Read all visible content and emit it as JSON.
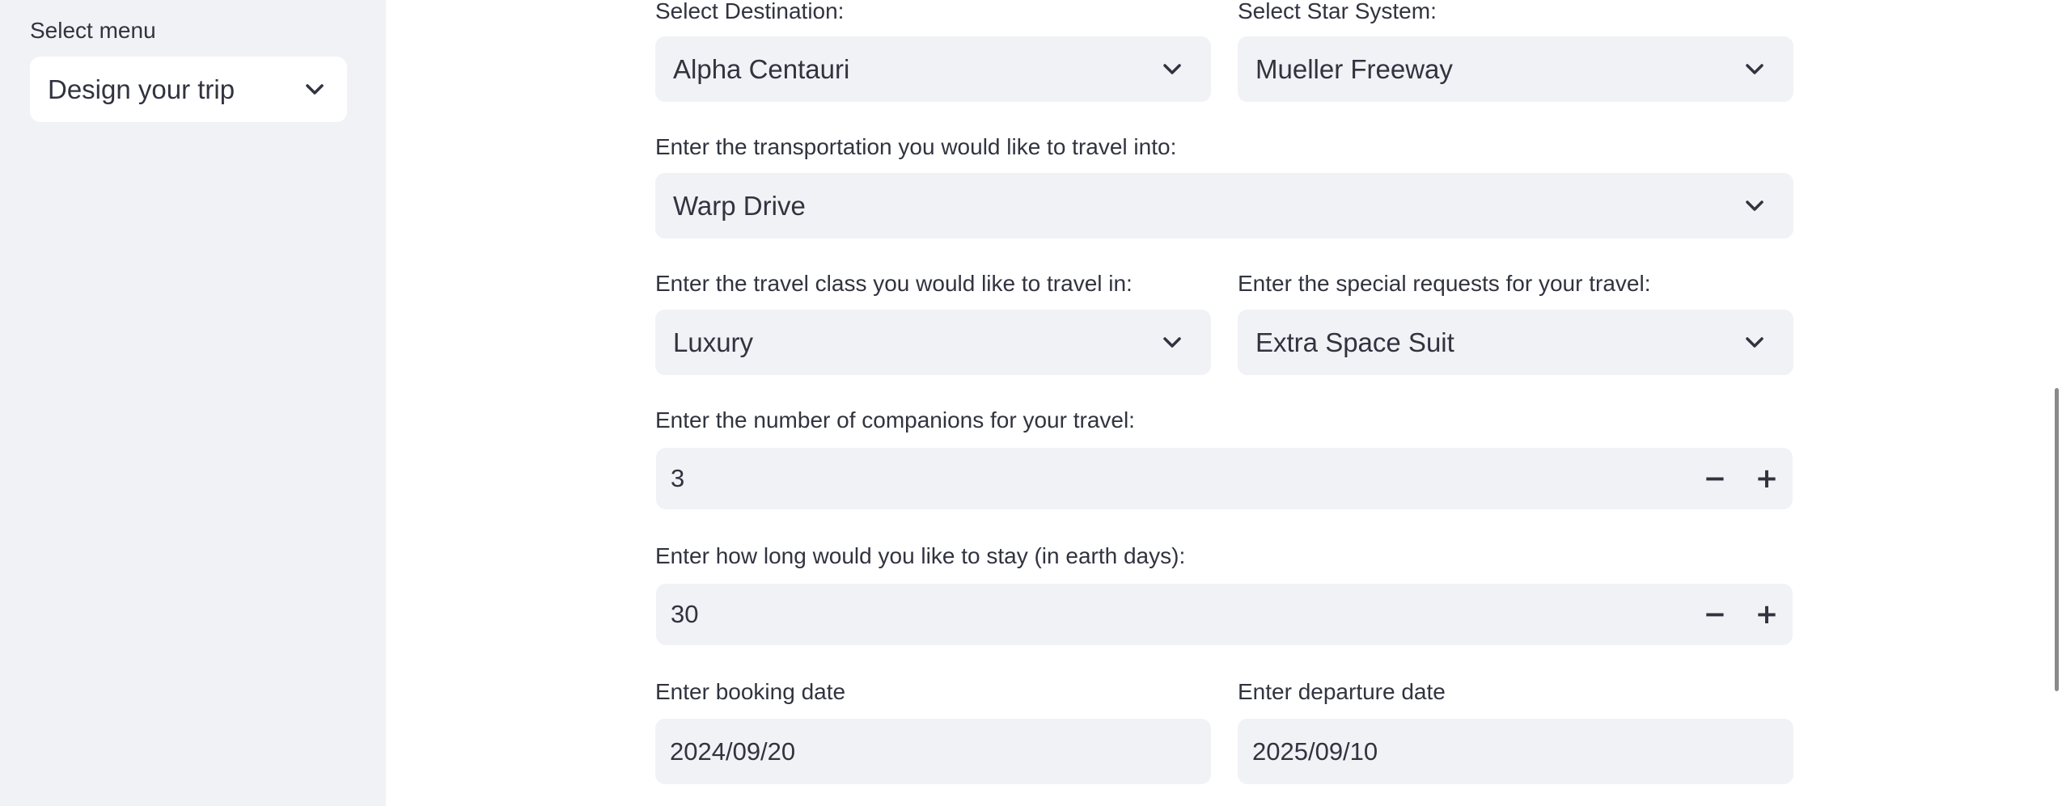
{
  "sidebar": {
    "label": "Select menu",
    "selected": "Design your trip"
  },
  "form": {
    "destination": {
      "label": "Select Destination:",
      "value": "Alpha Centauri"
    },
    "star_system": {
      "label": "Select Star System:",
      "value": "Mueller Freeway"
    },
    "transportation": {
      "label": "Enter the transportation you would like to travel into:",
      "value": "Warp Drive"
    },
    "travel_class": {
      "label": "Enter the travel class you would like to travel in:",
      "value": "Luxury"
    },
    "special_requests": {
      "label": "Enter the special requests for your travel:",
      "value": "Extra Space Suit"
    },
    "companions": {
      "label": "Enter the number of companions for your travel:",
      "value": "3",
      "minus": "−",
      "plus": "+"
    },
    "stay_length": {
      "label": "Enter how long would you like to stay (in earth days):",
      "value": "30",
      "minus": "−",
      "plus": "+"
    },
    "booking_date": {
      "label": "Enter booking date",
      "value": "2024/09/20"
    },
    "departure_date": {
      "label": "Enter departure date",
      "value": "2025/09/10"
    }
  },
  "icons": {
    "chevron": "chevron-down-icon"
  },
  "colors": {
    "sidebar_bg": "#f0f2f6",
    "field_bg": "#f0f2f6",
    "text": "#31333f"
  }
}
